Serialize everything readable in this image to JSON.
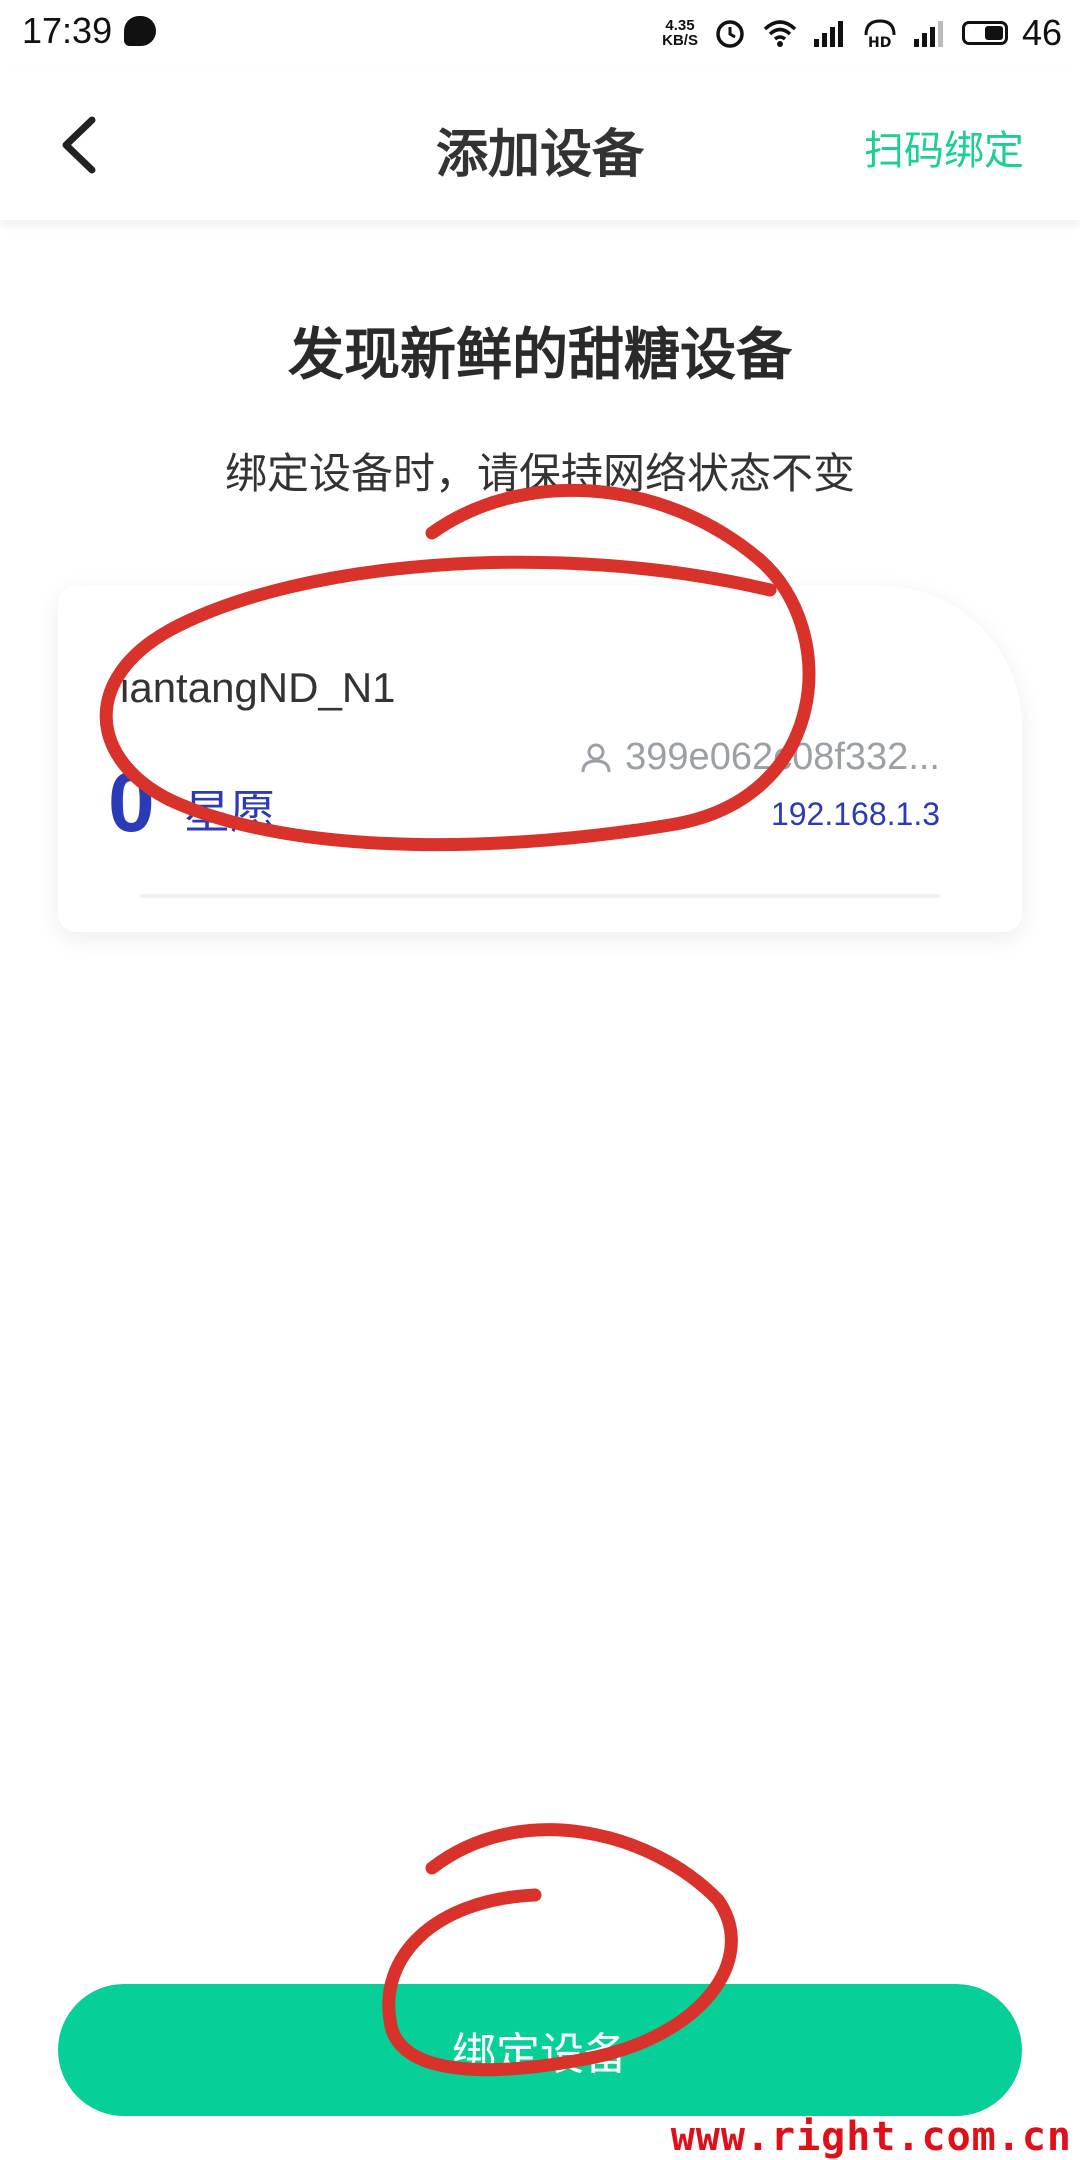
{
  "status_bar": {
    "time": "17:39",
    "net_speed_value": "4.35",
    "net_speed_unit": "KB/S",
    "battery_percent": "46",
    "icons": [
      "message-icon",
      "alarm-icon",
      "wifi-icon",
      "signal-4g-icon",
      "hd-icon",
      "signal-icon",
      "battery-icon"
    ]
  },
  "header": {
    "title": "添加设备",
    "scan_bind_label": "扫码绑定",
    "accent_color": "#1ccf97"
  },
  "main": {
    "headline": "发现新鲜的甜糖设备",
    "subtitle": "绑定设备时，请保持网络状态不变"
  },
  "device_card": {
    "name": "iantangND_N1",
    "stars_value": "0",
    "stars_label": "星愿",
    "user_id": "399e062c08f332...",
    "ip": "192.168.1.3",
    "value_color": "#2b3bb8"
  },
  "bind_button": {
    "label": "绑定设备",
    "color": "#07cf98"
  },
  "watermark": {
    "text": "www.right.com.cn"
  }
}
